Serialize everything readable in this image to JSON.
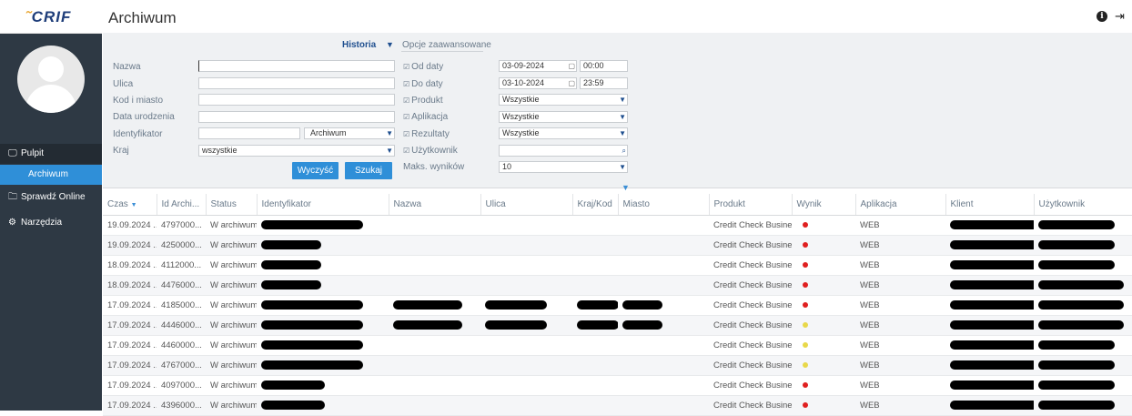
{
  "app": {
    "logo_text": "CRIF",
    "page_title": "Archiwum"
  },
  "sidebar": {
    "items": [
      {
        "label": "Pulpit"
      },
      {
        "label": "Archiwum"
      },
      {
        "label": "Sprawdź Online"
      },
      {
        "label": "Narzędzia"
      }
    ]
  },
  "filters": {
    "tab_historia": "Historia",
    "tab_opcje": "Opcje zaawansowane",
    "nazwa_label": "Nazwa",
    "ulica_label": "Ulica",
    "kod_label": "Kod i miasto",
    "data_label": "Data urodzenia",
    "identyfikator_label": "Identyfikator",
    "identyfikator_type": "Archiwum",
    "kraj_label": "Kraj",
    "kraj_value": "wszystkie",
    "clear_button": "Wyczyść",
    "search_button": "Szukaj",
    "od_daty_label": "Od daty",
    "od_daty_date": "03-09-2024",
    "od_daty_time": "00:00",
    "do_daty_label": "Do daty",
    "do_daty_date": "03-10-2024",
    "do_daty_time": "23:59",
    "produkt_label": "Produkt",
    "produkt_value": "Wszystkie",
    "aplikacja_label": "Aplikacja",
    "aplikacja_value": "Wszystkie",
    "rezultaty_label": "Rezultaty",
    "rezultaty_value": "Wszystkie",
    "uzytkownik_label": "Użytkownik",
    "maks_label": "Maks. wyników",
    "maks_value": "10"
  },
  "table": {
    "columns": [
      "Czas",
      "Id Archi...",
      "Status",
      "Identyfikator",
      "Nazwa",
      "Ulica",
      "Kraj/Kod",
      "Miasto",
      "Produkt",
      "Wynik",
      "Aplikacja",
      "Klient",
      "Użytkownik"
    ],
    "rows": [
      {
        "czas": "19.09.2024 ...",
        "id": "4797000...",
        "status": "W archiwum",
        "produkt": "Credit Check Business",
        "wynik": "red",
        "aplikacja": "WEB"
      },
      {
        "czas": "19.09.2024 ...",
        "id": "4250000...",
        "status": "W archiwum",
        "produkt": "Credit Check Business",
        "wynik": "red",
        "aplikacja": "WEB"
      },
      {
        "czas": "18.09.2024 ...",
        "id": "4112000...",
        "status": "W archiwum",
        "produkt": "Credit Check Business",
        "wynik": "red",
        "aplikacja": "WEB"
      },
      {
        "czas": "18.09.2024 ...",
        "id": "4476000...",
        "status": "W archiwum",
        "produkt": "Credit Check Business",
        "wynik": "red",
        "aplikacja": "WEB"
      },
      {
        "czas": "17.09.2024 ...",
        "id": "4185000...",
        "status": "W archiwum",
        "produkt": "Credit Check Business",
        "wynik": "red",
        "aplikacja": "WEB"
      },
      {
        "czas": "17.09.2024 ...",
        "id": "4446000...",
        "status": "W archiwum",
        "produkt": "Credit Check Business",
        "wynik": "yellow",
        "aplikacja": "WEB"
      },
      {
        "czas": "17.09.2024 ...",
        "id": "4460000...",
        "status": "W archiwum",
        "produkt": "Credit Check Business",
        "wynik": "yellow",
        "aplikacja": "WEB"
      },
      {
        "czas": "17.09.2024 ...",
        "id": "4767000...",
        "status": "W archiwum",
        "produkt": "Credit Check Business",
        "wynik": "yellow",
        "aplikacja": "WEB"
      },
      {
        "czas": "17.09.2024 ...",
        "id": "4097000...",
        "status": "W archiwum",
        "produkt": "Credit Check Business",
        "wynik": "red",
        "aplikacja": "WEB"
      },
      {
        "czas": "17.09.2024 ...",
        "id": "4396000...",
        "status": "W archiwum",
        "produkt": "Credit Check Business",
        "wynik": "red",
        "aplikacja": "WEB"
      }
    ]
  },
  "colors": {
    "accent": "#2f8fd8",
    "sidebar": "#2e3944",
    "result_red": "#e02020",
    "result_yellow": "#e8d84a"
  },
  "icons": {
    "info": "info-icon",
    "logout": "logout-icon",
    "monitor": "monitor-icon",
    "folder": "folder-icon",
    "gears": "gears-icon",
    "calendar": "calendar-icon",
    "search": "search-icon"
  }
}
